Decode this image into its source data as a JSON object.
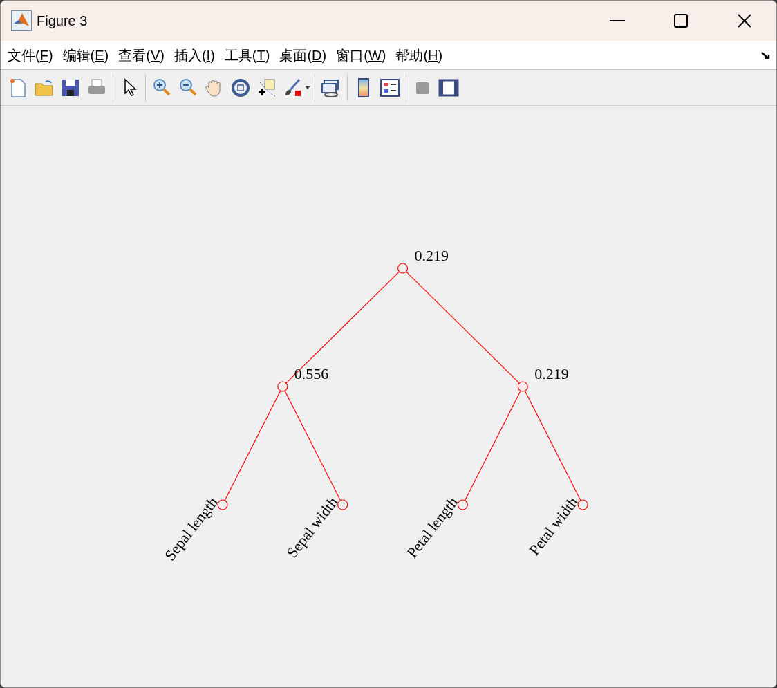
{
  "window": {
    "title": "Figure 3"
  },
  "menu": [
    {
      "before": "文件(",
      "key": "F",
      "after": ")"
    },
    {
      "before": "编辑(",
      "key": "E",
      "after": ")"
    },
    {
      "before": "查看(",
      "key": "V",
      "after": ")"
    },
    {
      "before": "插入(",
      "key": "I",
      "after": ")"
    },
    {
      "before": "工具(",
      "key": "T",
      "after": ")"
    },
    {
      "before": "桌面(",
      "key": "D",
      "after": ")"
    },
    {
      "before": "窗口(",
      "key": "W",
      "after": ")"
    },
    {
      "before": "帮助(",
      "key": "H",
      "after": ")"
    }
  ],
  "tree": {
    "label": "0.219",
    "children": [
      {
        "label": "0.556",
        "children": [
          {
            "label": "Sepal length"
          },
          {
            "label": "Sepal width"
          }
        ]
      },
      {
        "label": "0.219",
        "children": [
          {
            "label": "Petal length"
          },
          {
            "label": "Petal width"
          }
        ]
      }
    ]
  }
}
